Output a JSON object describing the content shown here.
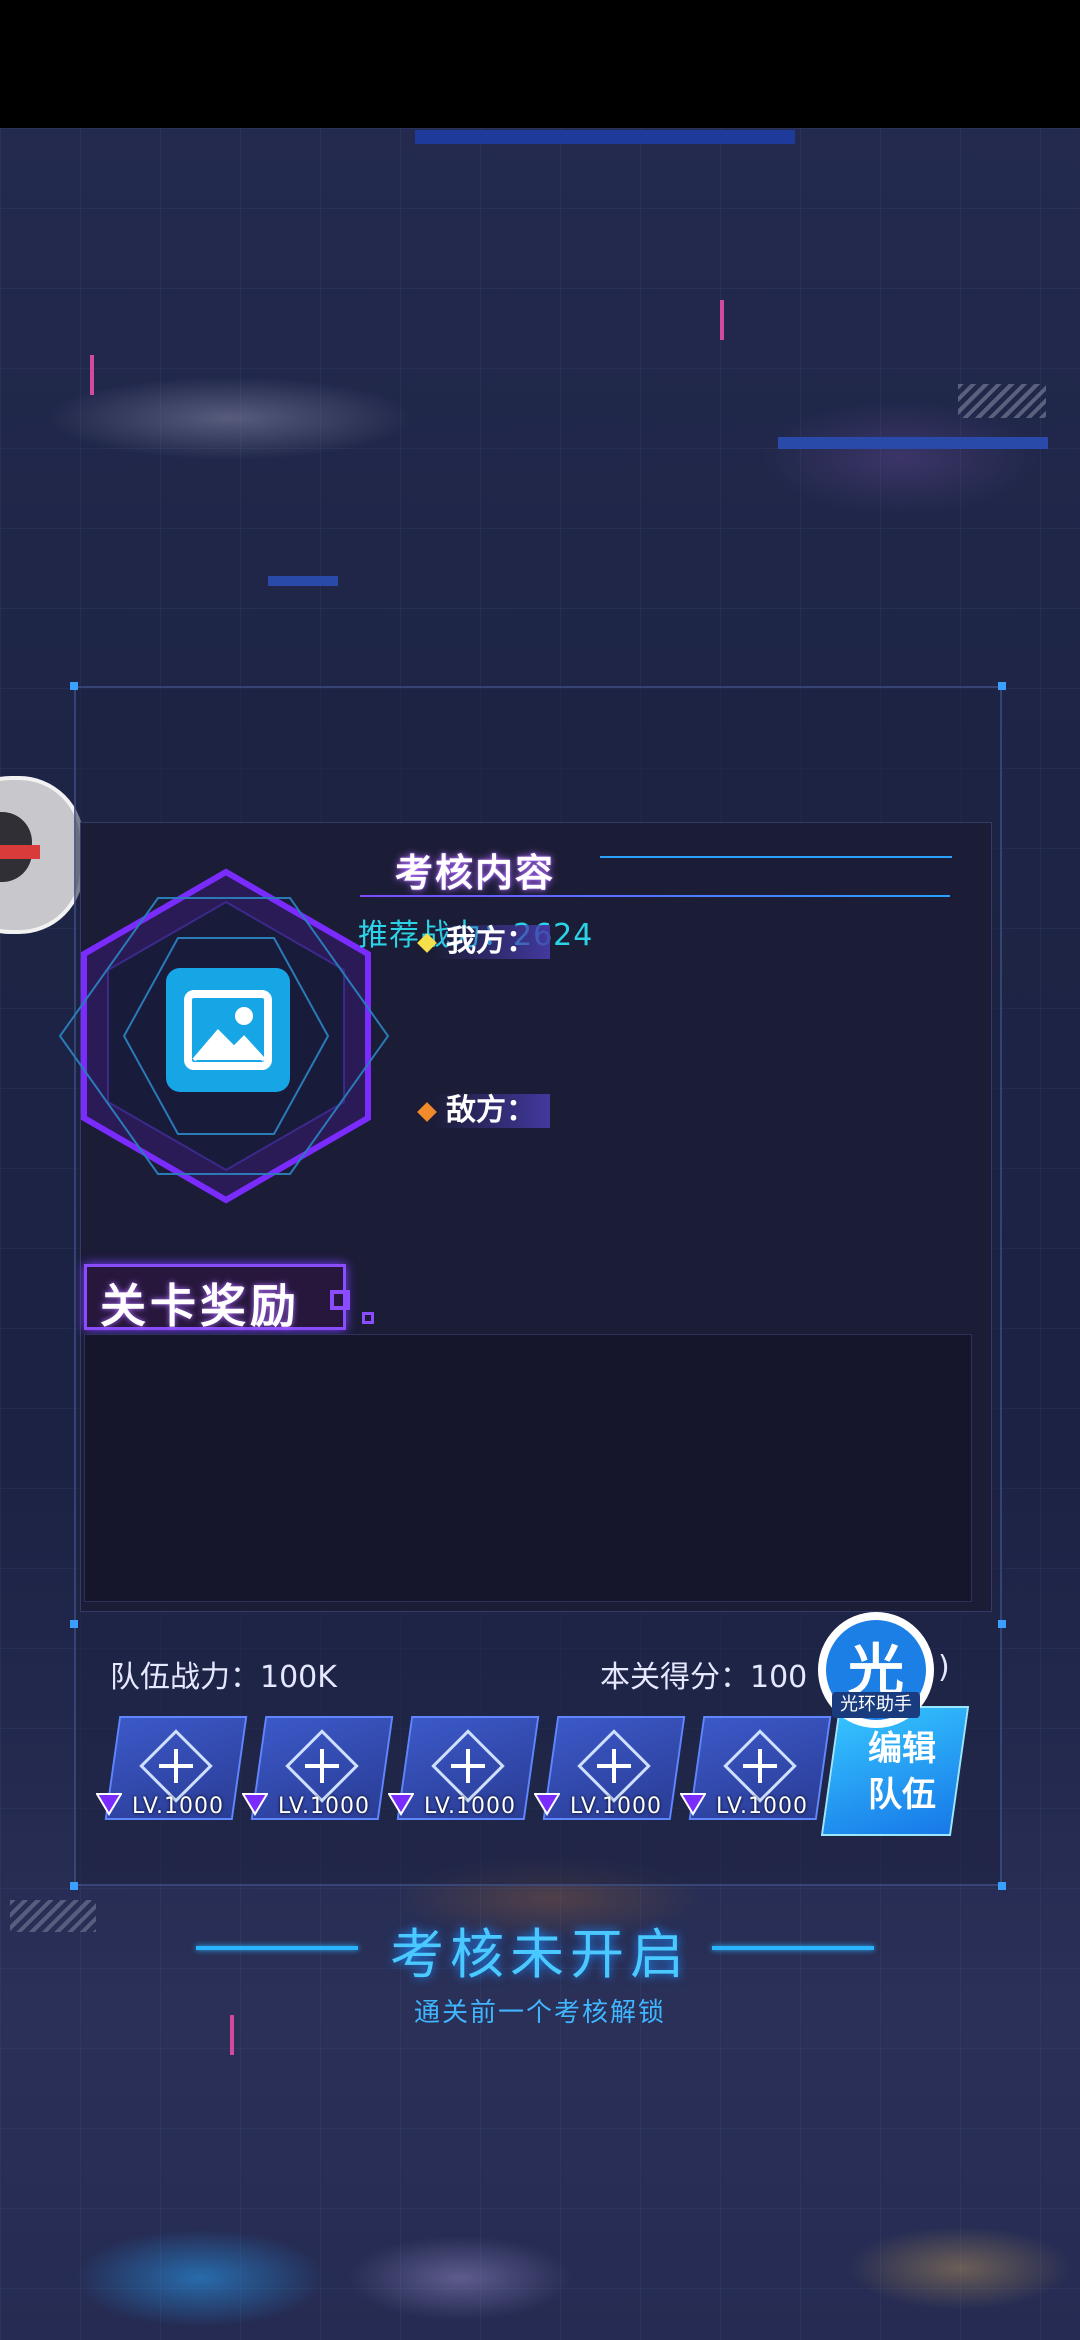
{
  "assessment": {
    "title": "考核内容",
    "recommended_power": "推荐战力：2624",
    "ours_label": "我方：",
    "enemy_label": "敌方："
  },
  "stage_reward": {
    "title": "关卡奖励"
  },
  "team": {
    "power_label": "队伍战力：100K",
    "score_label": "本关得分：100",
    "score_trailing": ")",
    "slots": [
      {
        "level": "LV.1000"
      },
      {
        "level": "LV.1000"
      },
      {
        "level": "LV.1000"
      },
      {
        "level": "LV.1000"
      },
      {
        "level": "LV.1000"
      }
    ],
    "edit_button_line1": "编辑",
    "edit_button_line2": "队伍"
  },
  "helper": {
    "glyph": "光",
    "caption": "光环助手"
  },
  "locked": {
    "title": "考核未开启",
    "subtitle": "通关前一个考核解锁"
  },
  "colors": {
    "accent_purple": "#8a4cff",
    "accent_cyan": "#2bd3e6",
    "accent_blue": "#2ab3ff"
  }
}
